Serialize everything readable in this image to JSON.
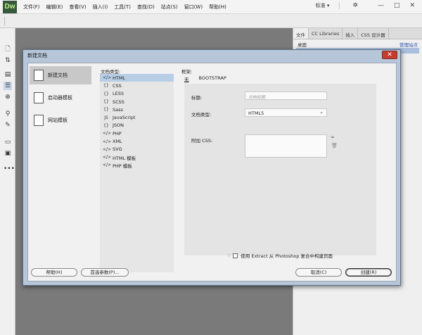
{
  "app": {
    "logo": "Dw",
    "menu": [
      "文件(F)",
      "编辑(E)",
      "查看(V)",
      "插入(I)",
      "工具(T)",
      "查找(D)",
      "站点(S)",
      "窗口(W)",
      "帮助(H)"
    ],
    "layout": "标准 ▾",
    "gear": "✲",
    "window_controls": [
      "—",
      "□",
      "✕"
    ]
  },
  "panel": {
    "tabs": [
      "文件",
      "CC Libraries",
      "插入",
      "CSS 设计器"
    ],
    "row1_left": "桌面",
    "row1_right": "管理站点"
  },
  "dialog": {
    "title": "新建文档",
    "close": "✕",
    "categories": [
      "新建文档",
      "启动器模板",
      "网站模板"
    ],
    "doctype_label": "文档类型:",
    "doctypes": [
      {
        "icon": "</>",
        "label": "HTML"
      },
      {
        "icon": "{}",
        "label": "CSS"
      },
      {
        "icon": "{}",
        "label": "LESS"
      },
      {
        "icon": "{}",
        "label": "SCSS"
      },
      {
        "icon": "{}",
        "label": "Sass"
      },
      {
        "icon": "JS",
        "label": "JavaScript"
      },
      {
        "icon": "{}",
        "label": "JSON"
      },
      {
        "icon": "</>",
        "label": "PHP"
      },
      {
        "icon": "</>",
        "label": "XML"
      },
      {
        "icon": "</>",
        "label": "SVG"
      },
      {
        "icon": "</>",
        "label": "HTML 模板"
      },
      {
        "icon": "</>",
        "label": "PHP 模板"
      }
    ],
    "frame_label": "框架:",
    "frame_tabs": [
      "无",
      "BOOTSTRAP"
    ],
    "title_label": "标题:",
    "title_placeholder": "文档标题",
    "doctype_field_label": "文档类型:",
    "doctype_value": "HTML5",
    "attach_css_label": "附加 CSS:",
    "photoshop_option": "使用 Extract 从 Photoshop 复合中构建页面",
    "buttons": {
      "help": "帮助(H)",
      "preferences": "首选参数(P)...",
      "cancel": "取消(C)",
      "create": "创建(R)"
    }
  }
}
